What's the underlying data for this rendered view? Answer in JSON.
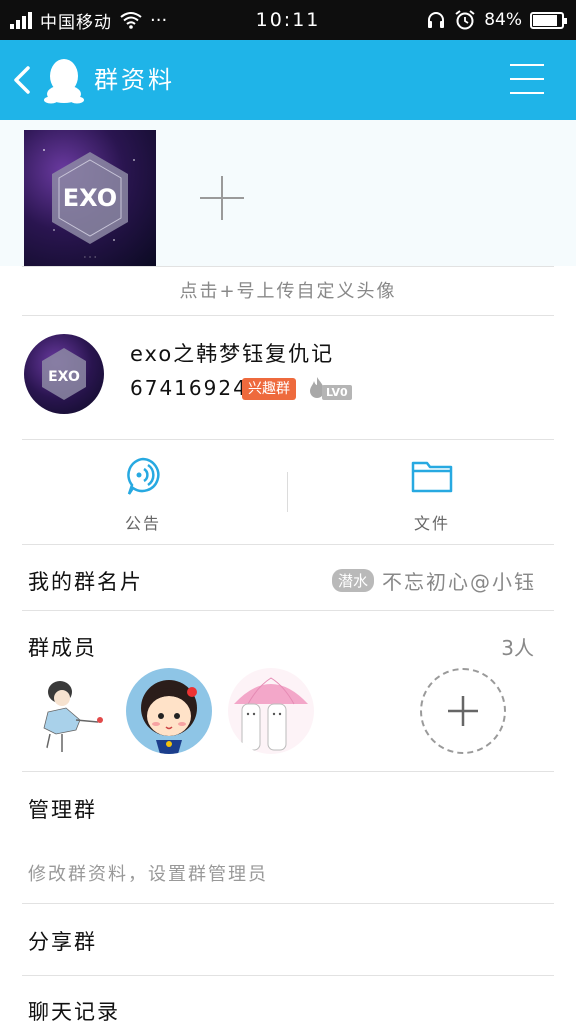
{
  "status_bar": {
    "carrier": "中国移动",
    "dots": "···",
    "time": "10:11",
    "battery": "84%",
    "battery_level": 0.84
  },
  "nav": {
    "title": "群资料"
  },
  "upload": {
    "hint": "点击+号上传自定义头像"
  },
  "group": {
    "name": "exo之韩梦钰复仇记",
    "id": "674169240",
    "tag": "兴趣群",
    "level": "LV0"
  },
  "actions": [
    {
      "label": "公告",
      "icon": "announcement-icon"
    },
    {
      "label": "文件",
      "icon": "folder-icon"
    }
  ],
  "card": {
    "label": "我的群名片",
    "tag": "潜水",
    "value": "不忘初心@小钰"
  },
  "members": {
    "label": "群成员",
    "count": "3人"
  },
  "manage": {
    "label": "管理群",
    "subtitle": "修改群资料，设置群管理员"
  },
  "share": {
    "label": "分享群"
  },
  "history": {
    "label": "聊天记录"
  },
  "colors": {
    "nav_bg": "#1fb4e8",
    "accent": "#27a9e1",
    "tag_interest": "#ee6a3d"
  }
}
